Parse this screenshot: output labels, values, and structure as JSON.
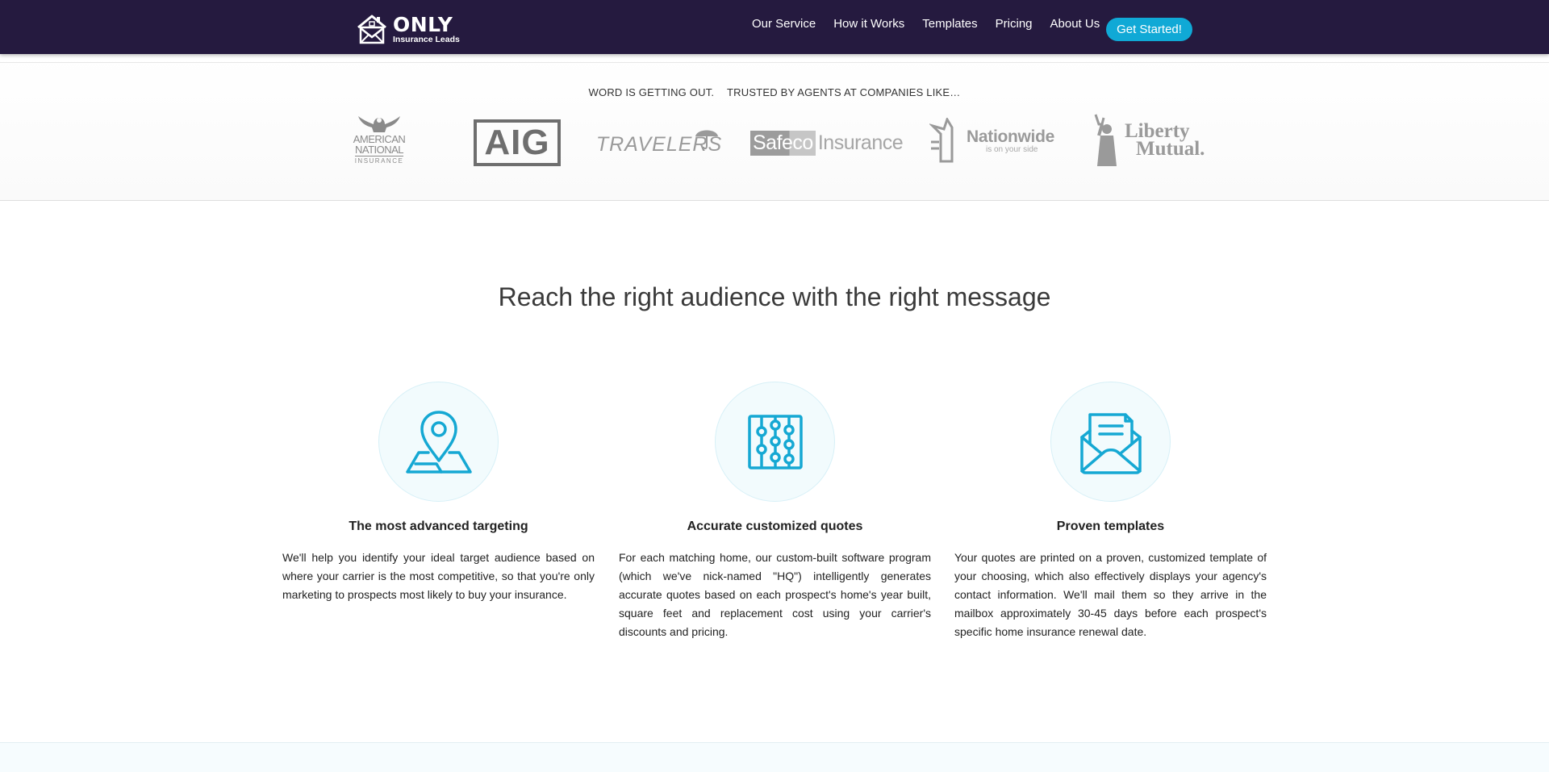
{
  "brand": {
    "name": "ONLY",
    "subtitle": "Insurance Leads"
  },
  "nav": {
    "links": [
      "Our Service",
      "How it Works",
      "Templates",
      "Pricing",
      "About Us"
    ],
    "cta_label": "Get Started!"
  },
  "trusted": {
    "caption_left": "WORD IS GETTING OUT.",
    "caption_right": "TRUSTED BY AGENTS AT COMPANIES LIKE…",
    "logos": {
      "american_national": [
        "AMERICAN",
        "NATIONAL",
        "INSURANCE"
      ],
      "aig": "AIG",
      "travelers": "TRAVELERS",
      "safeco_a": "Safeco",
      "safeco_b": "Insurance",
      "nationwide": "Nationwide",
      "nationwide_tag": "is on your side",
      "liberty_a": "Liberty",
      "liberty_b": "Mutual."
    }
  },
  "main": {
    "title": "Reach the right audience with the right message",
    "features": [
      {
        "icon": "map-pin-icon",
        "title": "The most advanced targeting",
        "body": "We'll help you identify your ideal target audience based on where your carrier is the most competitive, so that you're only marketing to prospects most likely to buy your insurance."
      },
      {
        "icon": "abacus-icon",
        "title": "Accurate customized quotes",
        "body": "For each matching home, our custom-built software program (which we've nick-named \"HQ\") intelligently generates accurate quotes based on each prospect's home's year built, square feet and replacement cost using your carrier's discounts and pricing."
      },
      {
        "icon": "envelope-open-icon",
        "title": "Proven templates",
        "body": "Your quotes are printed on a proven, customized template of your choosing, which also effectively displays your agency's contact information. We'll mail them so they arrive in the mailbox approximately 30-45 days before each prospect's specific home insurance renewal date."
      }
    ]
  },
  "colors": {
    "nav_bg": "#251a3f",
    "accent": "#10a9d6",
    "logo_gray": "#8a8a8a"
  }
}
